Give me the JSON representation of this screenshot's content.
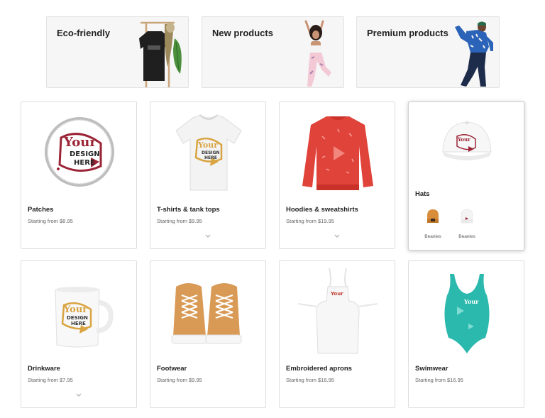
{
  "banners": [
    {
      "title": "Eco-friendly",
      "icon": "clothes-rack-image"
    },
    {
      "title": "New products",
      "icon": "yoga-model-image"
    },
    {
      "title": "Premium products",
      "icon": "dancer-model-image"
    }
  ],
  "products": [
    {
      "name": "Patches",
      "price": "Starting from $8.95",
      "icon": "patch-image",
      "expandable": false
    },
    {
      "name": "T-shirts & tank tops",
      "price": "Starting from $9.95",
      "icon": "tshirt-image",
      "expandable": true
    },
    {
      "name": "Hoodies & sweatshirts",
      "price": "Starting from $19.95",
      "icon": "sweatshirt-image",
      "expandable": true
    },
    {
      "name": "Hats",
      "icon": "hat-image",
      "subcategories": [
        {
          "label": "Beanies",
          "icon": "beanie-orange-image"
        },
        {
          "label": "Beanies",
          "icon": "beanie-white-image"
        }
      ]
    },
    {
      "name": "Drinkware",
      "price": "Starting from $7.95",
      "icon": "mug-image",
      "expandable": true
    },
    {
      "name": "Footwear",
      "price": "Starting from $9.95",
      "icon": "sneakers-image",
      "expandable": false
    },
    {
      "name": "Embroidered aprons",
      "price": "Starting from $16.95",
      "icon": "apron-image",
      "expandable": false
    },
    {
      "name": "Swimwear",
      "price": "Starting from $16.95",
      "icon": "swimsuit-image",
      "expandable": false
    }
  ],
  "logo_text": {
    "your": "Your",
    "design": "DESIGN",
    "here": "HERE"
  },
  "colors": {
    "accent": "#9b2335",
    "gold": "#d9a441",
    "sweatshirt": "#e0433a",
    "teal": "#2bb8ad",
    "sneaker": "#d89a55"
  }
}
